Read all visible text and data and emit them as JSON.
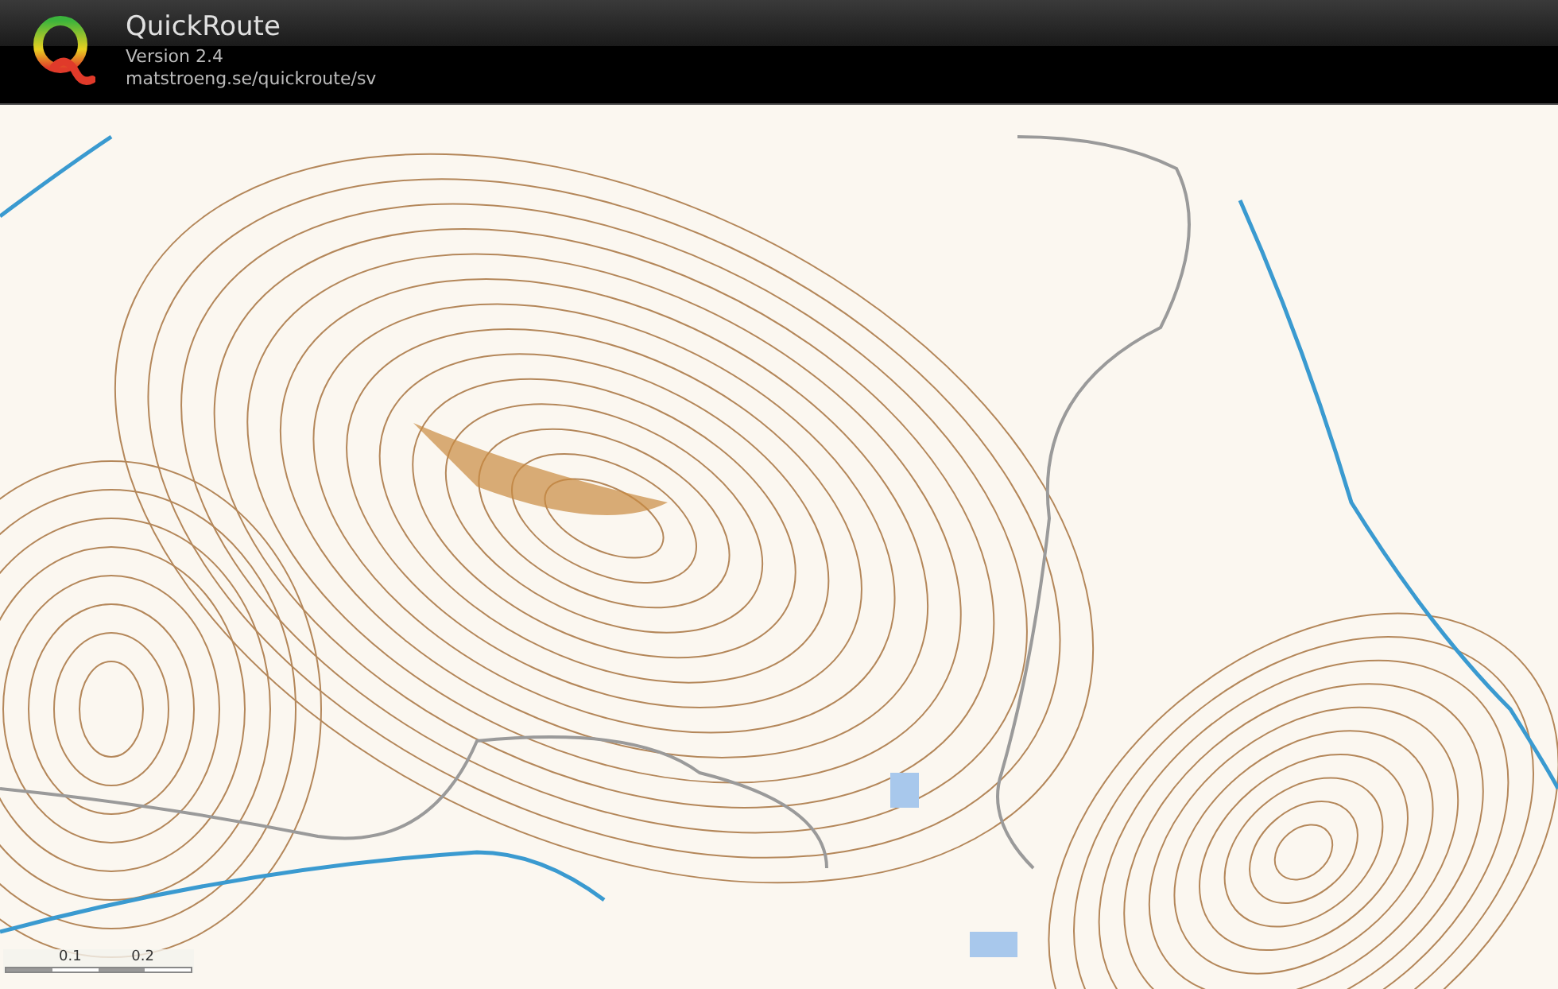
{
  "header": {
    "title": "QuickRoute",
    "version": "Version 2.4",
    "url": "matstroeng.se/quickroute/sv"
  },
  "scale_bar": {
    "labels": [
      "0.1",
      "0.2"
    ]
  }
}
